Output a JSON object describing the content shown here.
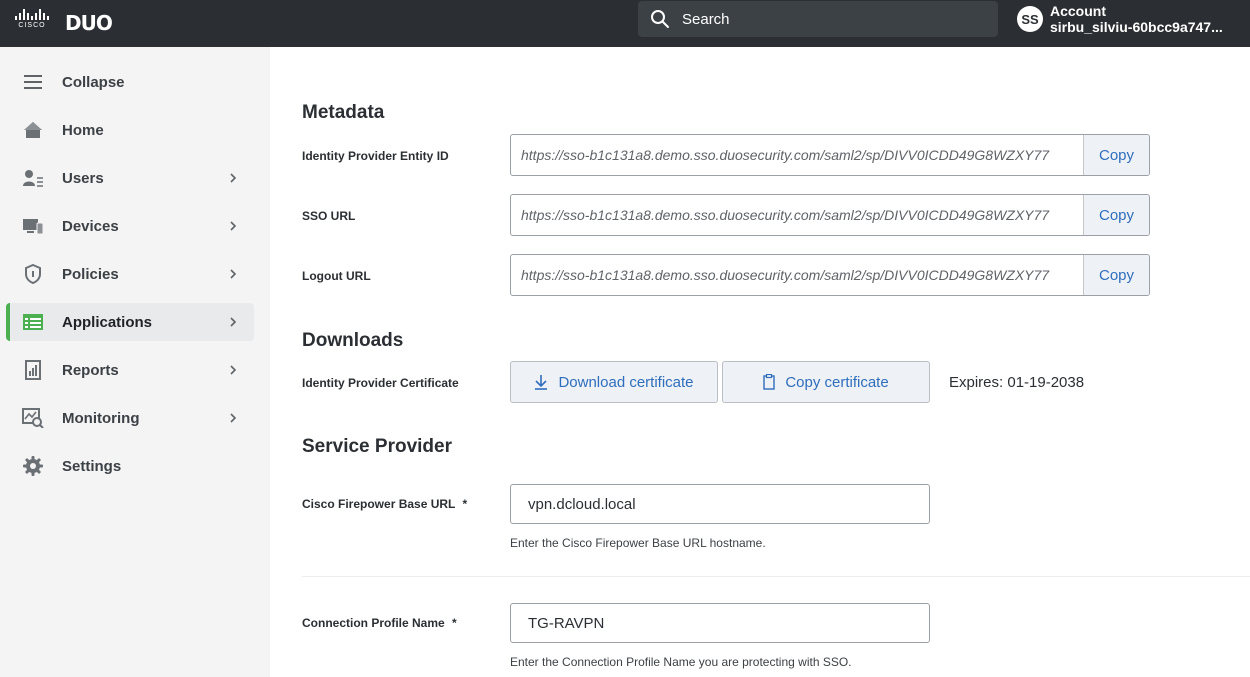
{
  "header": {
    "cisco_logo_text": "CISCO",
    "duo_logo_text": "DUO",
    "search_label": "Search",
    "account": {
      "avatar_initials": "SS",
      "label": "Account",
      "name": "sirbu_silviu-60bcc9a747..."
    }
  },
  "sidebar": {
    "items": [
      {
        "label": "Collapse",
        "icon": "menu-icon",
        "chevron": false,
        "active": false
      },
      {
        "label": "Home",
        "icon": "home-icon",
        "chevron": false,
        "active": false
      },
      {
        "label": "Users",
        "icon": "users-icon",
        "chevron": true,
        "active": false
      },
      {
        "label": "Devices",
        "icon": "devices-icon",
        "chevron": true,
        "active": false
      },
      {
        "label": "Policies",
        "icon": "shield-icon",
        "chevron": true,
        "active": false
      },
      {
        "label": "Applications",
        "icon": "applications-icon",
        "chevron": true,
        "active": true
      },
      {
        "label": "Reports",
        "icon": "reports-icon",
        "chevron": true,
        "active": false
      },
      {
        "label": "Monitoring",
        "icon": "monitoring-icon",
        "chevron": true,
        "active": false
      },
      {
        "label": "Settings",
        "icon": "gear-icon",
        "chevron": false,
        "active": false
      }
    ],
    "active_color": "#4caf50"
  },
  "main": {
    "metadata": {
      "title": "Metadata",
      "fields": [
        {
          "label": "Identity Provider Entity ID",
          "value": "https://sso-b1c131a8.demo.sso.duosecurity.com/saml2/sp/DIVV0ICDD49G8WZXY77",
          "copy_label": "Copy"
        },
        {
          "label": "SSO URL",
          "value": "https://sso-b1c131a8.demo.sso.duosecurity.com/saml2/sp/DIVV0ICDD49G8WZXY77",
          "copy_label": "Copy"
        },
        {
          "label": "Logout URL",
          "value": "https://sso-b1c131a8.demo.sso.duosecurity.com/saml2/sp/DIVV0ICDD49G8WZXY77",
          "copy_label": "Copy"
        }
      ]
    },
    "downloads": {
      "title": "Downloads",
      "cert_label": "Identity Provider Certificate",
      "download_label": "Download certificate",
      "copy_cert_label": "Copy certificate",
      "expires": "Expires: 01-19-2038"
    },
    "service_provider": {
      "title": "Service Provider",
      "base_url": {
        "label": "Cisco Firepower Base URL",
        "required": "*",
        "value": "vpn.dcloud.local",
        "help": "Enter the Cisco Firepower Base URL hostname."
      },
      "profile_name": {
        "label": "Connection Profile Name",
        "required": "*",
        "value": "TG-RAVPN",
        "help": "Enter the Connection Profile Name you are protecting with SSO."
      }
    }
  },
  "colors": {
    "topbar": "#2b2f33",
    "link": "#2f6ebd",
    "button_bg": "#eef1f6"
  }
}
